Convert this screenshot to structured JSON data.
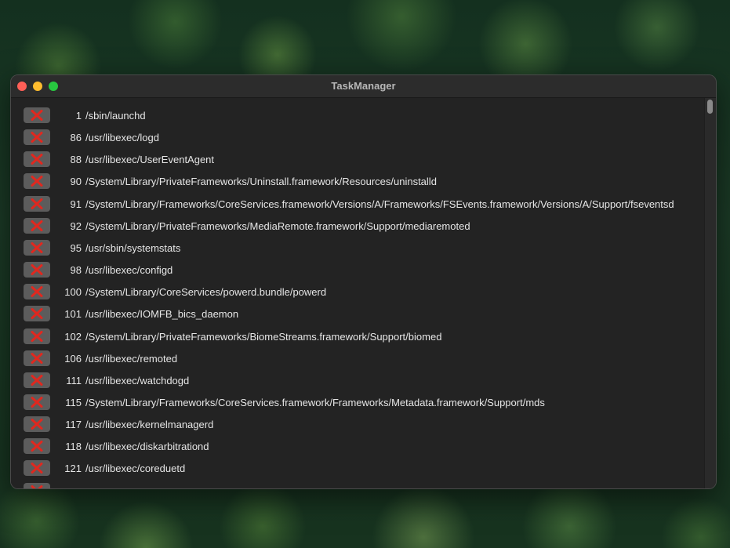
{
  "desktop": {
    "wallpaper": "forest-aerial"
  },
  "window": {
    "title": "TaskManager",
    "controls": [
      "close",
      "minimize",
      "zoom"
    ]
  },
  "kill_icon": "close-x-icon",
  "processes": [
    {
      "pid": "1",
      "path": "/sbin/launchd"
    },
    {
      "pid": "86",
      "path": "/usr/libexec/logd"
    },
    {
      "pid": "88",
      "path": "/usr/libexec/UserEventAgent"
    },
    {
      "pid": "90",
      "path": "/System/Library/PrivateFrameworks/Uninstall.framework/Resources/uninstalld"
    },
    {
      "pid": "91",
      "path": "/System/Library/Frameworks/CoreServices.framework/Versions/A/Frameworks/FSEvents.framework/Versions/A/Support/fseventsd"
    },
    {
      "pid": "92",
      "path": "/System/Library/PrivateFrameworks/MediaRemote.framework/Support/mediaremoted"
    },
    {
      "pid": "95",
      "path": "/usr/sbin/systemstats"
    },
    {
      "pid": "98",
      "path": "/usr/libexec/configd"
    },
    {
      "pid": "100",
      "path": "/System/Library/CoreServices/powerd.bundle/powerd"
    },
    {
      "pid": "101",
      "path": "/usr/libexec/IOMFB_bics_daemon"
    },
    {
      "pid": "102",
      "path": "/System/Library/PrivateFrameworks/BiomeStreams.framework/Support/biomed"
    },
    {
      "pid": "106",
      "path": "/usr/libexec/remoted"
    },
    {
      "pid": "111",
      "path": "/usr/libexec/watchdogd"
    },
    {
      "pid": "115",
      "path": "/System/Library/Frameworks/CoreServices.framework/Frameworks/Metadata.framework/Support/mds"
    },
    {
      "pid": "117",
      "path": "/usr/libexec/kernelmanagerd"
    },
    {
      "pid": "118",
      "path": "/usr/libexec/diskarbitrationd"
    },
    {
      "pid": "121",
      "path": "/usr/libexec/coreduetd"
    }
  ],
  "colors": {
    "kill_x": "#e0281f",
    "kill_button_bg": "#5c5c5c",
    "text": "#e6e6e6",
    "window_bg": "#232323"
  }
}
